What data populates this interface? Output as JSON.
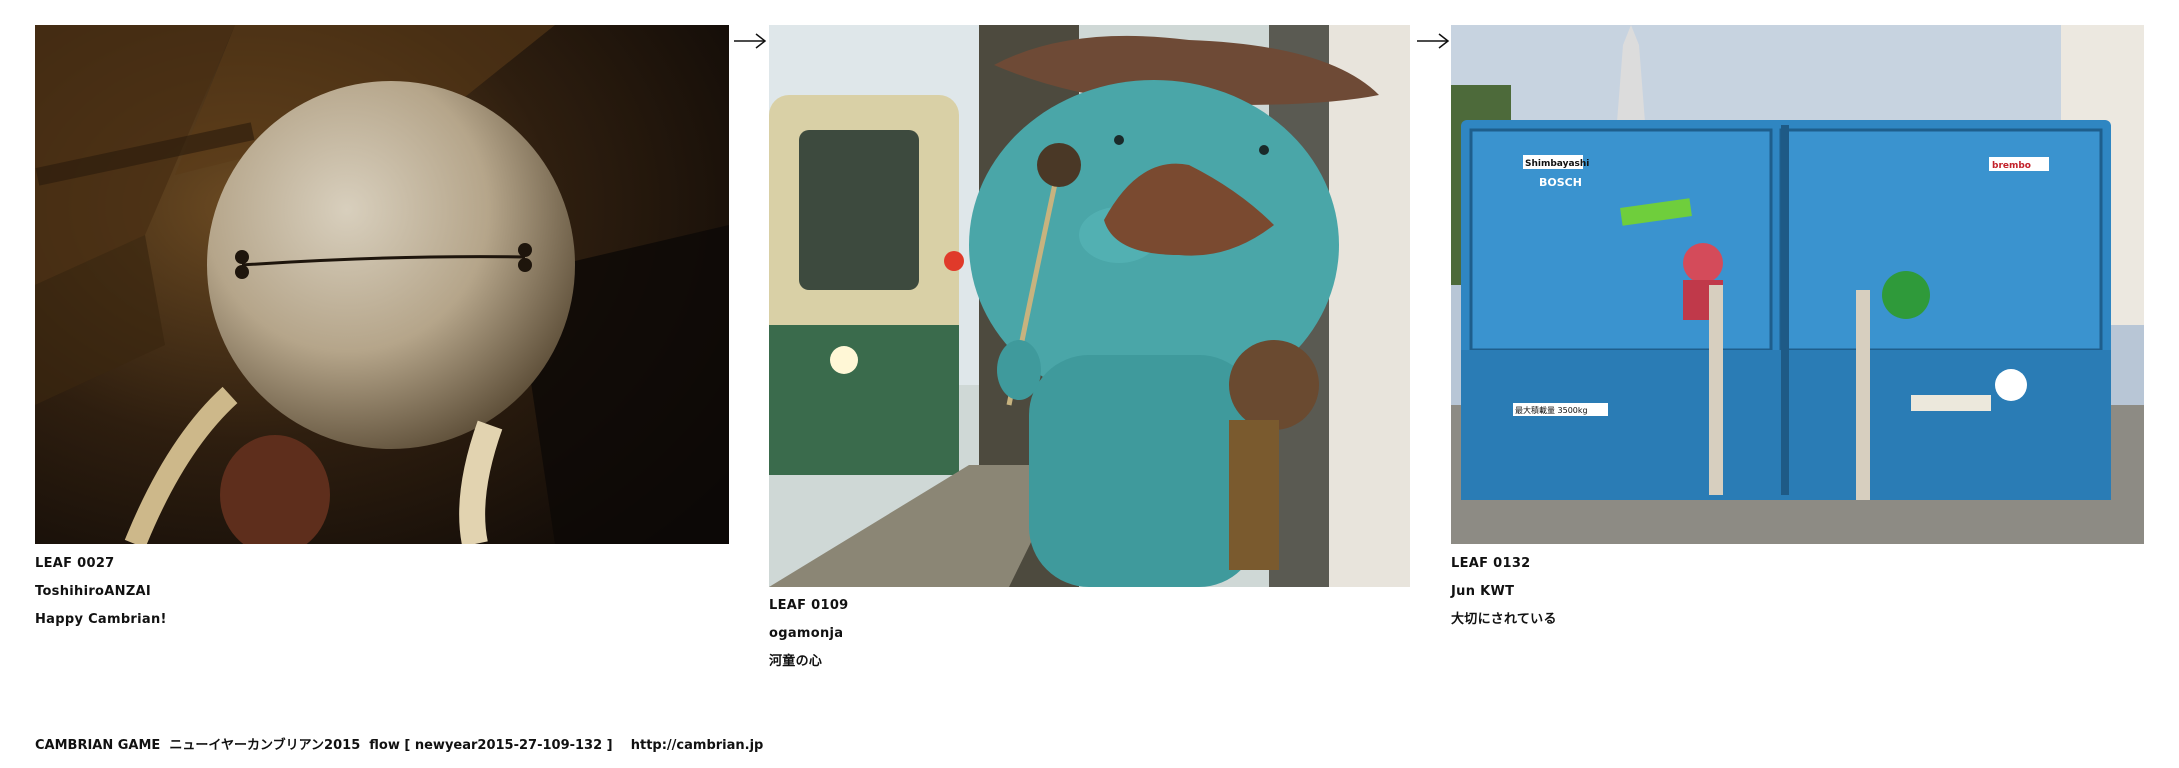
{
  "leaves": [
    {
      "id": "LEAF 0027",
      "author": "ToshihiroANZAI",
      "title": "Happy Cambrian!"
    },
    {
      "id": "LEAF 0109",
      "author": "ogamonja",
      "title": "河童の心"
    },
    {
      "id": "LEAF 0132",
      "author": "Jun KWT",
      "title": "大切にされている"
    }
  ],
  "truck_photo_text": {
    "sticker_1": "Shimbayashi",
    "sticker_2": "BOSCH",
    "sticker_3": "brembo",
    "plate": "最大積載量 3500kg"
  },
  "footer": {
    "text": "CAMBRIAN GAME  ニューイヤーカンブリアン2015  flow [ newyear2015-27-109-132 ]",
    "link": "http://cambrian.jp"
  }
}
